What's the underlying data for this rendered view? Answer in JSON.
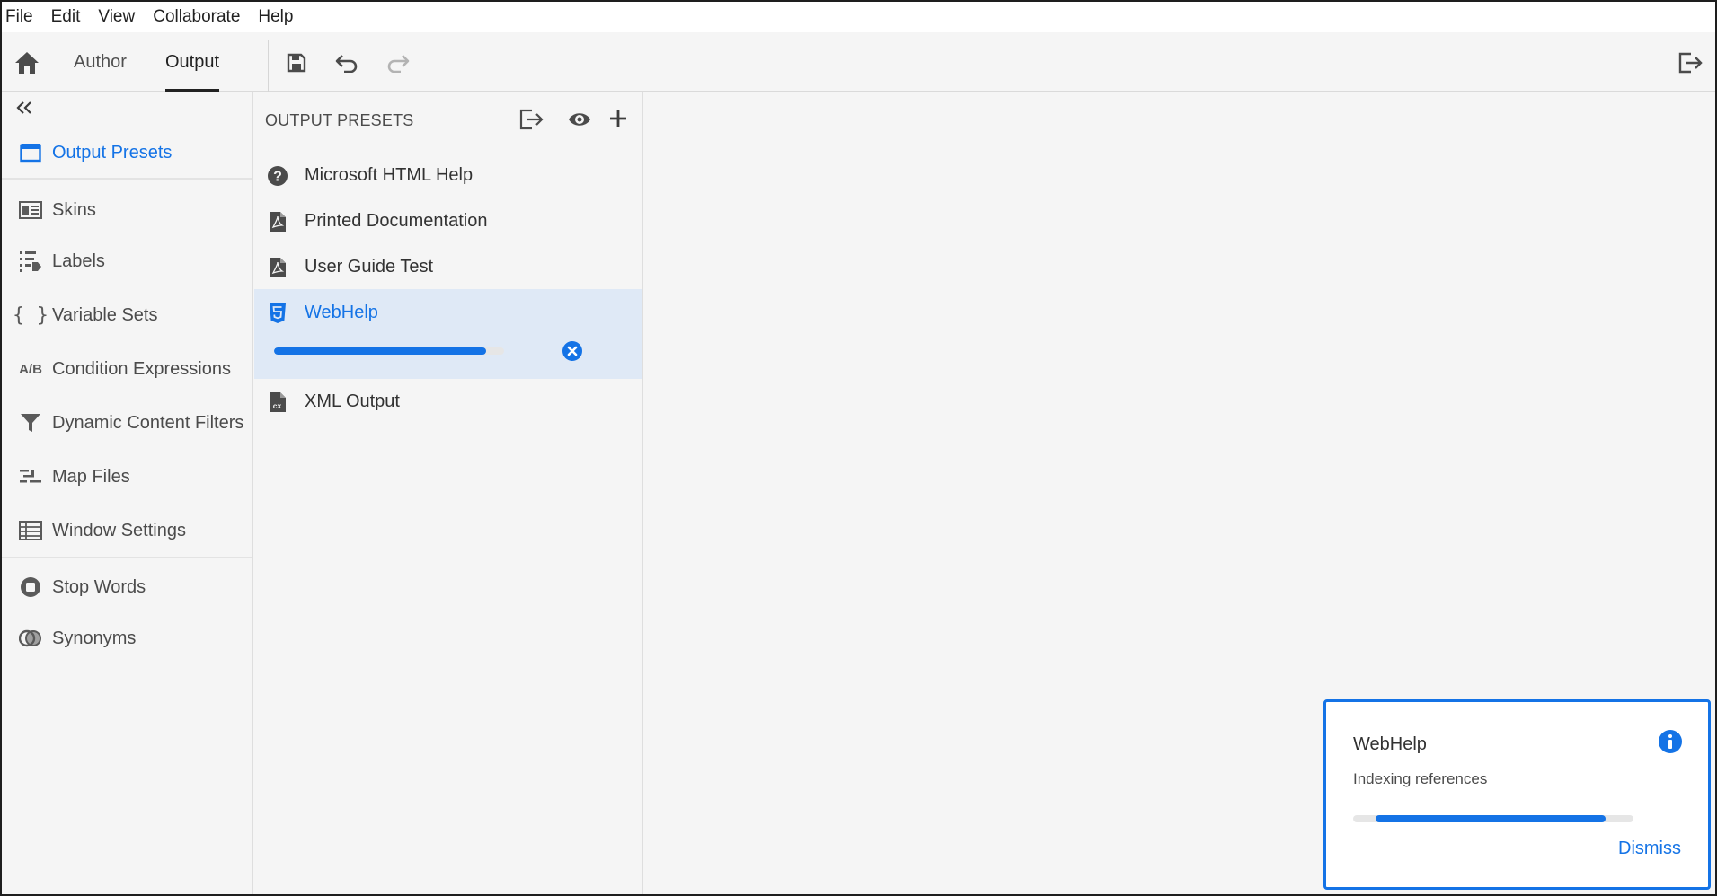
{
  "menubar": {
    "items": [
      "File",
      "Edit",
      "View",
      "Collaborate",
      "Help"
    ]
  },
  "toolbar": {
    "tabs": [
      "Author",
      "Output"
    ],
    "active_tab": "Output",
    "icons": [
      "home-icon",
      "save-icon",
      "undo-icon",
      "redo-icon",
      "exit-icon"
    ]
  },
  "leftnav": {
    "collapse_icon": "double-chevron-left-icon",
    "items": [
      {
        "label": "Output Presets",
        "icon": "output-presets-icon",
        "active": true
      },
      {
        "label": "Skins",
        "icon": "skins-icon"
      },
      {
        "label": "Labels",
        "icon": "labels-icon"
      },
      {
        "label": "Variable Sets",
        "icon": "braces-icon"
      },
      {
        "label": "Condition Expressions",
        "icon": "ab-icon",
        "icon_text": "A/B"
      },
      {
        "label": "Dynamic Content Filters",
        "icon": "filter-icon"
      },
      {
        "label": "Map Files",
        "icon": "map-files-icon"
      },
      {
        "label": "Window Settings",
        "icon": "window-settings-icon"
      },
      {
        "label": "Stop Words",
        "icon": "stop-words-icon"
      },
      {
        "label": "Synonyms",
        "icon": "synonyms-icon"
      }
    ]
  },
  "presets": {
    "header": "OUTPUT PRESETS",
    "header_icons": [
      "export-icon",
      "eye-icon",
      "plus-icon"
    ],
    "items": [
      {
        "label": "Microsoft HTML Help",
        "icon": "help-circle-icon"
      },
      {
        "label": "Printed Documentation",
        "icon": "pdf-file-icon"
      },
      {
        "label": "User Guide Test",
        "icon": "pdf-file-icon"
      },
      {
        "label": "WebHelp",
        "icon": "html5-icon",
        "selected": true
      },
      {
        "label": "XML Output",
        "icon": "xml-file-icon"
      }
    ],
    "webhelp_progress": 0.92
  },
  "toast": {
    "title": "WebHelp",
    "message": "Indexing references",
    "dismiss_label": "Dismiss",
    "progress": 0.9,
    "icon": "info-icon"
  },
  "colors": {
    "accent": "#1473e6",
    "selected_bg": "#dfe9f6",
    "background": "#f5f5f5"
  }
}
